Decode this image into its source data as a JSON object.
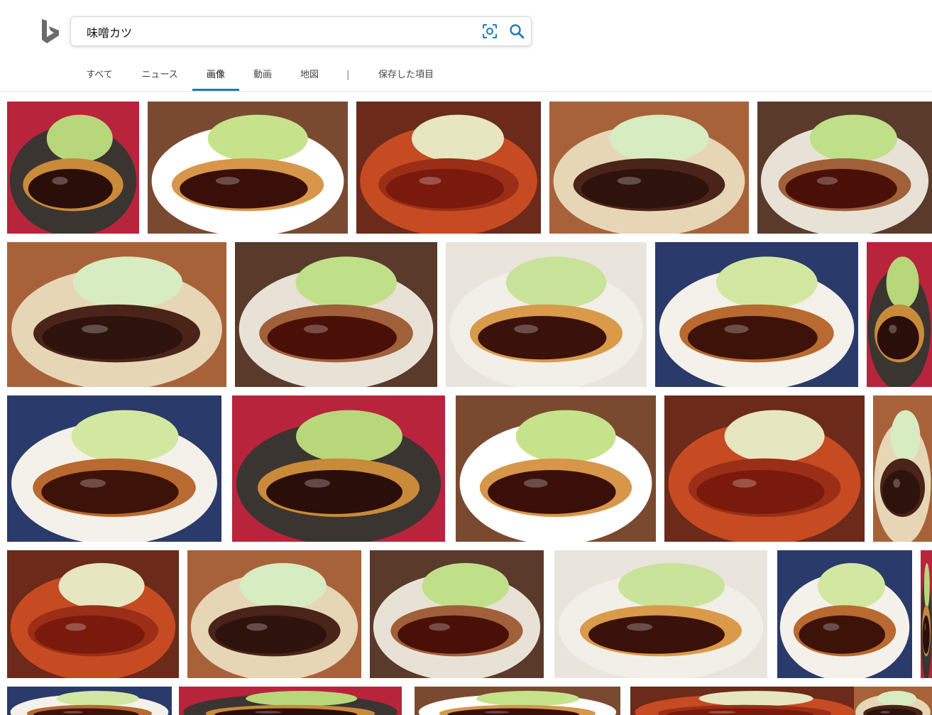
{
  "search": {
    "query": "味噌カツ",
    "visual_search_icon": "camera-scan-icon",
    "search_icon": "magnifier-icon"
  },
  "tabs": [
    {
      "label": "すべて",
      "active": false
    },
    {
      "label": "ニュース",
      "active": false
    },
    {
      "label": "画像",
      "active": true
    },
    {
      "label": "動画",
      "active": false
    },
    {
      "label": "地図",
      "active": false
    },
    {
      "label": "|",
      "separator": true
    },
    {
      "label": "保存した項目",
      "active": false
    }
  ],
  "colors": {
    "accent": "#1a7bbd",
    "logo": "#6b6b6b"
  },
  "results": {
    "subject": "味噌カツ",
    "rows": [
      {
        "count": 5,
        "kinds": [
          "tonkatsu-dark-plate",
          "sliced-katsu-brown",
          "kushikatsu-tray",
          "katsu-white-plate",
          "katsu-blue-plate"
        ]
      },
      {
        "count": 5,
        "kinds": [
          "katsu-striped-plate",
          "katsu-dark-sauce",
          "katsu-square-plate",
          "red-katsu-closeup",
          "partial-image"
        ]
      },
      {
        "count": 5,
        "kinds": [
          "katsu-salad",
          "red-miso-plate",
          "katsu-brown-rim",
          "katsu-cabbage-closeup",
          "partial-image"
        ]
      },
      {
        "count": 6,
        "kinds": [
          "katsudon-bowl",
          "sliced-katsu-closeup",
          "katsu-cabbage-mound",
          "katsu-round-plate",
          "katsu-framed-photo",
          "partial-image"
        ]
      },
      {
        "count": 5,
        "kinds": [
          "partial-image",
          "partial-image",
          "partial-image",
          "partial-image",
          "partial-image"
        ]
      }
    ]
  }
}
